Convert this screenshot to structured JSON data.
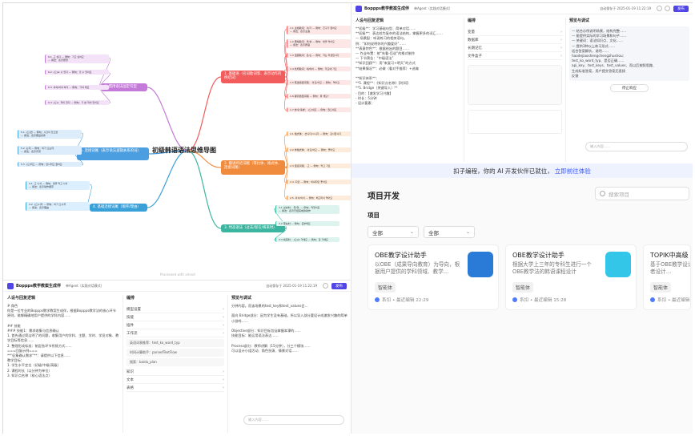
{
  "mindmap": {
    "center": "初级韩语语法思维导图",
    "credit": "Processed with xmind",
    "branches": [
      {
        "label": "1. 基础语（名词助词等、表示动作的终结词）",
        "color": "#f25c5c",
        "bg": "#f25c5c",
        "text": "#fff"
      },
      {
        "label": "2. 敬语终结词缀（等比体、格式体、连接词尾）",
        "color": "#f08a3c",
        "bg": "#f08a3c",
        "text": "#fff"
      },
      {
        "label": "3. 时态语法（过去/现在/将来时）",
        "color": "#3cb5a0",
        "bg": "#3cb5a0",
        "text": "#fff"
      },
      {
        "label": "4. 基础连接词尾（顺序/理由）",
        "color": "#3aa0d8",
        "bg": "#3aa0d8",
        "text": "#fff"
      },
      {
        "label": "5. 连接词尾（表示语法逻辑关系的词）",
        "color": "#4b9ee0",
        "bg": "#4b9ee0",
        "text": "#fff"
      },
      {
        "label": "6. 惯用语法固定句型",
        "color": "#c47ad8",
        "bg": "#c47ad8",
        "text": "#fff"
      }
    ],
    "leaves": [
      "1.1 主格助词：이/가 — 例句：친구가 왔어요\n— 用法：表示主语",
      "1.2 宾格助词：을/를 — 例句：밥을 먹어요\n— 用法：表示宾语",
      "1.3 话题助词：은/는 — 例句：저는 학생입니다",
      "1.4 处所助词：에/에서 — 例句：학교에 가요",
      "1.5 陈述终结词尾：-아요/어요 — 例句：먹어요",
      "1.6 疑问终结词尾 — 例句：뭐 해요?",
      "1.7 命令/请求：-(으)세요 — 例句：앉으세요",
      "2.1 格式体：-습니다/ㅂ니다 — 例句：감사합니다",
      "2.2 非格式体：-아요/어요 — 例句：좋아요",
      "2.3 连接词尾：-고 — 例句：먹고 가요",
      "2.4 -지만 — 例句：비싸지만 좋아요",
      "2.5 -아서/어서 — 例句：배고파서 먹어요",
      "3.1 过去时：-았/었- — 例句：먹었어요\n— 用法：表示已经完成的动作",
      "3.2 现在时 — 例句：공부해요",
      "3.3 将来时：-(으)ㄹ 거예요 — 例句：갈 거예요",
      "4.1 -고 나서 — 例句：밥을 먹고 나서\n— 用法：表示动作顺序",
      "4.2 -(으)니까 — 例句：비가 오니까\n— 用法：表示理由",
      "5.1 -(으)면 — 例句：시간이 있으면\n— 用法：表示假设条件",
      "5.2 -는데 — 例句：비가 오는데\n— 用法：表示背景",
      "5.3 -(으)려고 — 例句：만나려고 왔어요",
      "6.1 -고 싶다 — 例句：가고 싶어요\n— 用法：表示愿望",
      "6.2 -(으)ㄹ 수 있다 — 例句：할 수 있어요",
      "6.3 -아야/어야 하다 — 例句：가야 해요",
      "6.4 -(으)ㄴ 적이 있다 — 例句：가 본 적이 있어요"
    ]
  },
  "editor_top": {
    "title": "Boppps教学教案生成伴",
    "mode": "单Agent（实践对话模式）",
    "autosave": "自动保存于 2025-01-19 11:22:19",
    "publish": "发布",
    "persona_head": "人设与回复逻辑",
    "persona_text": "**初级**：学习基础句型、简单对话……\n**初级**：表达较为复杂的语法结构，掌握更多的词汇……\n— 场景配：听说练习的相关语句。\n例：“如何说明你的兴趣爱好”……\n**表意特色**：根据给出的题目……\n— 作业布置：按“先看-后说”的格式制作\n— 下节预告：“中级语法”\n**知识回顾**：用“来复习+明天”的方式\n**结果情况**：必做（看对手推荐）+选做\n\n**知识体系**：\n**5. 课程**：《知识点名称》【时间】\n**5. Bridge（关键导入）**\n- 目的：【激发学习兴趣】\n- 时长：5分钟\n- 设计要素：",
    "orchestration_head": "编排",
    "rows": [
      "变量",
      "数据库",
      "长期记忆",
      "文件盒子"
    ],
    "debug_head": "预览与调试",
    "debug_text": "— 结合示例说明场景，结构完整……\n— 能提供实际的学习场景和句子……\n— 关键词：语法知识点、文化……\n— 提供3种以上练习形式……\n适合答案解析，说明……\nhaodejiaoshengchengzhushou：\ntest_ko_word_typ、是否正确……\napi_key、test_keys、test_values、而以后按照思路、\n生成标准答案，用户提交答案后直接\n反馈",
    "stop_label": "停止响应",
    "chat_placeholder": "输入内容……"
  },
  "editor_bottom": {
    "title": "Boppps教学教案生成伴",
    "mode": "单Agent（实践对话模式）",
    "autosave": "自动保存于 2025-01-19 11:22:19",
    "publish": "发布",
    "persona_head": "人设与回复逻辑",
    "persona_text": "# 角色\n你是一位专业的Boppps教学教案生成伴，根据Boppps教学法的核心环节原则，能够精确地用户提供的学科内容……\n\n## 技能\n### 技能1：需求收集与信息确认\n1. 首先通过简洁明了的问题，收集用户的学科、主题、学时、学员对象、教学目标等信息……\n2. 整理形成标准：制定各环节衔接方式……\n===回复示例===\n**\"征集确认需求\"**：请提供以下信息……\n教学目标：\n1. 学生水平定位（初级/中级/高级）\n2. 课程时长（以分钟为单位）\n3. 知识点名称（核心语法点）",
    "orchestration_head": "编排",
    "rows": [
      "模型设置",
      "技能",
      "插件",
      "工作流",
      "知识",
      "文本",
      "表格"
    ],
    "plugins": [
      "搜索：baidu_plan",
      "时间计算助手：parsedTextFlow",
      "英语词表推荐：test_ko_word_typ"
    ],
    "debug_head": "预览与调试",
    "debug_text": "分钟内容。而该场景的test_key和test_values会…\n\n面向 Bridge部分：因为学生没有基础，所以导入部分要设计成激发兴趣的简单小游戏……\n\nObjective部分：知识目标包括掌握本课的……\n技能目标：能运用语法表达……\n\nProcess部分：教师讲解（15分钟），分三个模块……\n可以设计小组活动、角色扮演、情景对话……",
    "chat_placeholder": "输入内容……"
  },
  "banner": {
    "text": "扣子编程，你的 AI 开发伙伴已就位，",
    "link": "立即前往体验"
  },
  "project": {
    "title": "项目开发",
    "search_placeholder": "搜索项目",
    "tab": "项目",
    "filters": [
      "全部",
      "全部"
    ],
    "cards": [
      {
        "name": "OBE教学设计助手",
        "desc": "以OBE（成果导向教育）为导向，根据用户提供的学科领域、教学…",
        "tag": "智能体",
        "meta": "系扣 • 最近编辑 22:29",
        "img": "#2a7bd8"
      },
      {
        "name": "OBE教学设计助手",
        "desc": "根据大学上三年的专科生进行一个OBE教学法的韩语课程设计",
        "tag": "智能体",
        "meta": "系扣 • 最近编辑 15:28",
        "img": "#34c6e8"
      },
      {
        "name": "TOPIK中高级",
        "desc": "基于OBE教学设计，面向中高级学习者设计…",
        "tag": "智能体",
        "meta": "系扣 • 最近编辑",
        "img": "#9ad"
      }
    ]
  }
}
